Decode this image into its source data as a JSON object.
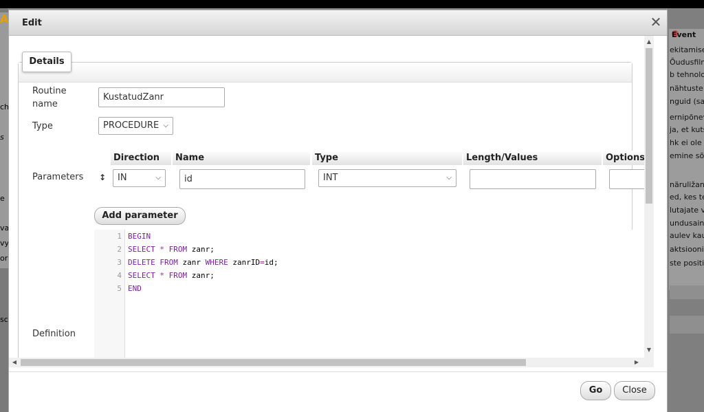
{
  "dialog": {
    "title": "Edit",
    "tab": "Details",
    "labels": {
      "routine_name_1": "Routine",
      "routine_name_2": "name",
      "type": "Type",
      "parameters": "Parameters",
      "definition": "Definition"
    },
    "routine_name_value": "KustatudZanr",
    "type_value": "PROCEDURE",
    "param_headers": [
      "Direction",
      "Name",
      "Type",
      "Length/Values",
      "Options"
    ],
    "param_row": {
      "direction": "IN",
      "name": "id",
      "type": "INT",
      "length": "",
      "options": ""
    },
    "add_parameter": "Add parameter",
    "definition_lines": [
      "BEGIN",
      "SELECT * FROM zanr;",
      "DELETE FROM zanr WHERE zanrID=id;",
      "SELECT * FROM zanr;",
      "END"
    ],
    "line_numbers": [
      "1",
      "2",
      "3",
      "4",
      "5"
    ],
    "go_button": "Go",
    "close_button": "Close"
  },
  "background_right": {
    "events_label": "Event",
    "snippets": [
      "ekitamise",
      "Õudusfilm",
      "b tehnolo",
      "nähtuste",
      "nguid (sag",
      "ernipõnev",
      "ja, et kuts",
      "hk ei ole",
      "emine sõ",
      "näruližan",
      "ed, kes te",
      "lutajate v",
      "undusain",
      "aulev kau",
      "aktsioonid",
      "ste positii"
    ]
  },
  "background_left": {
    "snippets": [
      "A",
      "ch",
      "s",
      "e",
      "va",
      "vy",
      "or",
      "sc"
    ]
  },
  "colors": {
    "keyword": "#7a1fa0",
    "operator": "#a0308a",
    "events_link": "#1f4e8c"
  }
}
